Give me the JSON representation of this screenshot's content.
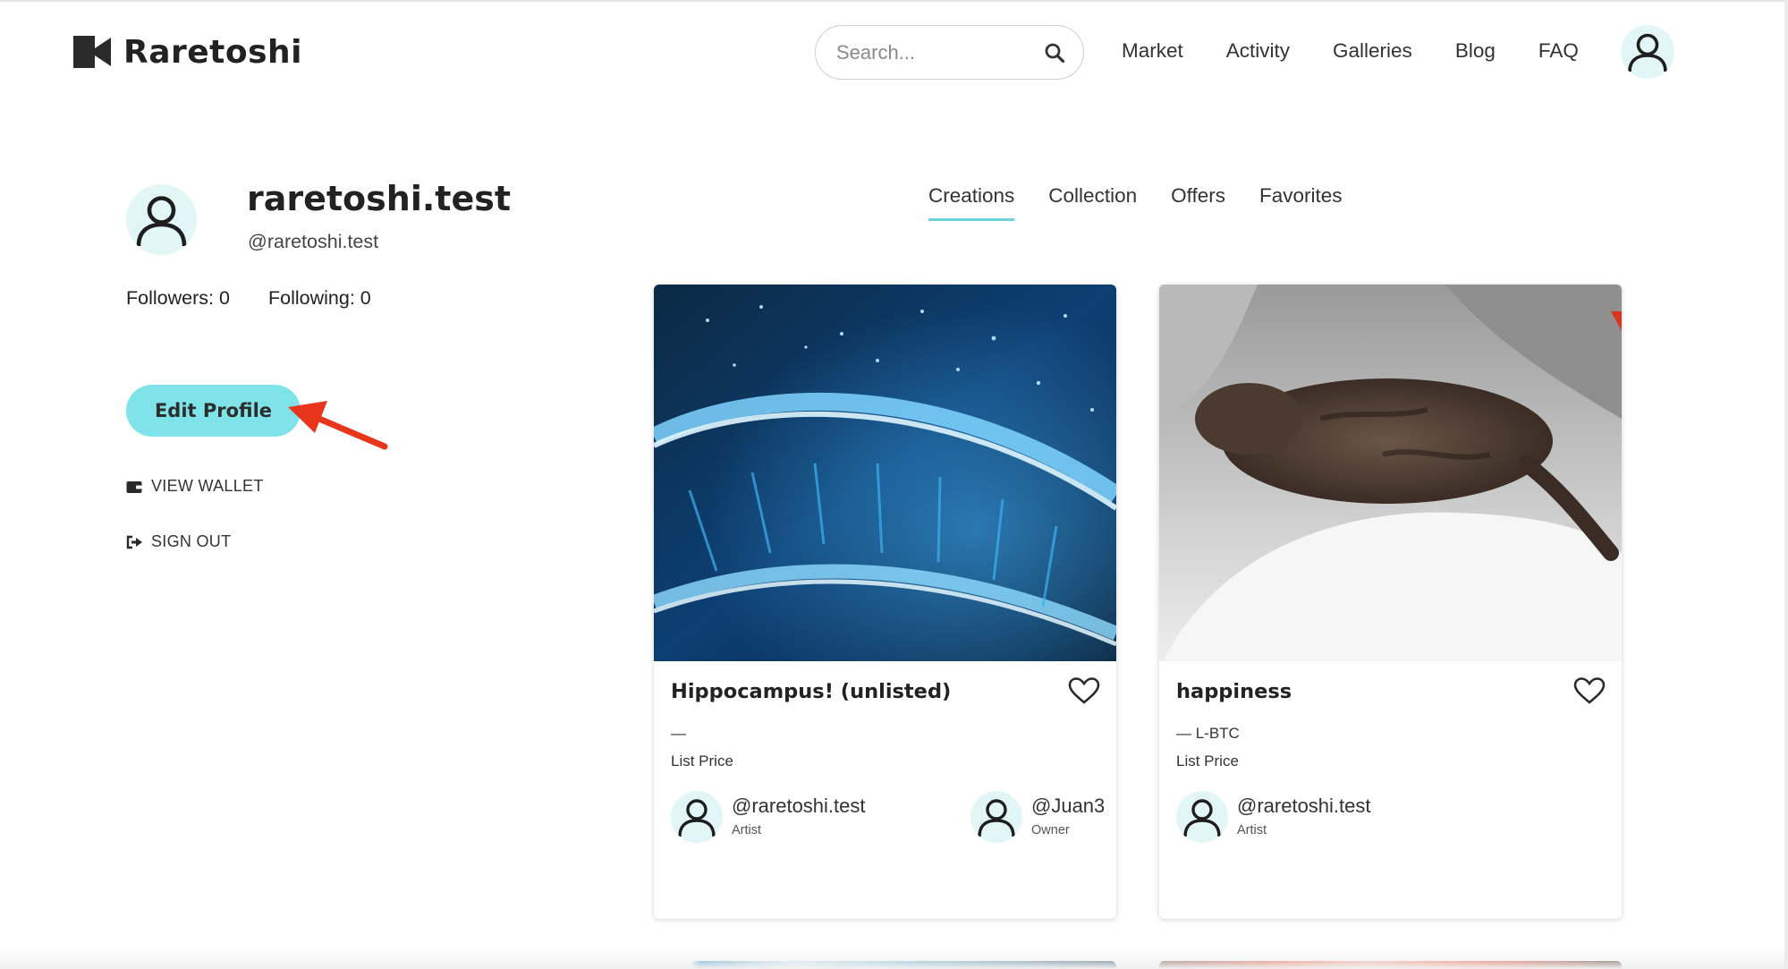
{
  "header": {
    "brand": "Raretoshi",
    "search_placeholder": "Search...",
    "nav": [
      "Market",
      "Activity",
      "Galleries",
      "Blog",
      "FAQ"
    ]
  },
  "profile": {
    "name": "raretoshi.test",
    "handle": "@raretoshi.test",
    "followers": "Followers: 0",
    "following": "Following: 0",
    "edit_label": "Edit Profile",
    "view_wallet": "VIEW WALLET",
    "sign_out": "SIGN OUT"
  },
  "tabs": [
    {
      "label": "Creations",
      "active": true
    },
    {
      "label": "Collection",
      "active": false
    },
    {
      "label": "Offers",
      "active": false
    },
    {
      "label": "Favorites",
      "active": false
    }
  ],
  "cards": [
    {
      "title": "Hippocampus! (unlisted)",
      "price": "—",
      "price_label": "List Price",
      "artist": {
        "handle": "@raretoshi.test",
        "role": "Artist"
      },
      "owner": {
        "handle": "@Juan3",
        "role": "Owner"
      }
    },
    {
      "title": "happiness",
      "price": "— L-BTC",
      "price_label": "List Price",
      "artist": {
        "handle": "@raretoshi.test",
        "role": "Artist"
      }
    }
  ],
  "colors": {
    "accent": "#7ee4ea",
    "tab_underline": "#6fd3db",
    "annotation_arrow": "#e8361c"
  }
}
